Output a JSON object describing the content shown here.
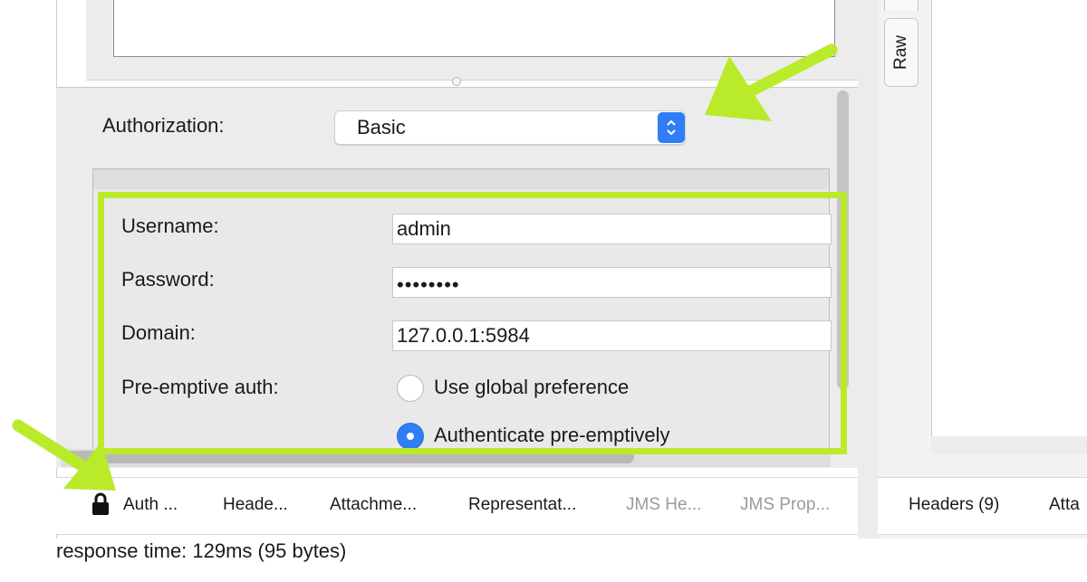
{
  "authorization": {
    "label": "Authorization:",
    "selected": "Basic"
  },
  "form": {
    "username": {
      "label": "Username:",
      "value": "admin"
    },
    "password": {
      "label": "Password:",
      "value": "••••••••"
    },
    "domain": {
      "label": "Domain:",
      "value": "127.0.0.1:5984"
    },
    "preemptive": {
      "label": "Pre-emptive auth:",
      "options": [
        {
          "label": "Use global preference",
          "selected": false
        },
        {
          "label": "Authenticate pre-emptively",
          "selected": true
        }
      ]
    }
  },
  "bottom_tabs": [
    {
      "label": "Auth ...",
      "icon": "lock-icon",
      "enabled": true
    },
    {
      "label": "Heade...",
      "enabled": true
    },
    {
      "label": "Attachme...",
      "enabled": true
    },
    {
      "label": "Representat...",
      "enabled": true
    },
    {
      "label": "JMS He...",
      "enabled": false
    },
    {
      "label": "JMS Prop...",
      "enabled": false
    }
  ],
  "status": {
    "text": "response time: 129ms (95 bytes)"
  },
  "right_panel": {
    "side_tab": "Raw",
    "tabs": [
      {
        "label": "Headers (9)"
      },
      {
        "label": "Atta"
      }
    ]
  },
  "colors": {
    "highlight": "#b9eb2a",
    "accent": "#2f7ef5",
    "panel": "#ececec"
  }
}
